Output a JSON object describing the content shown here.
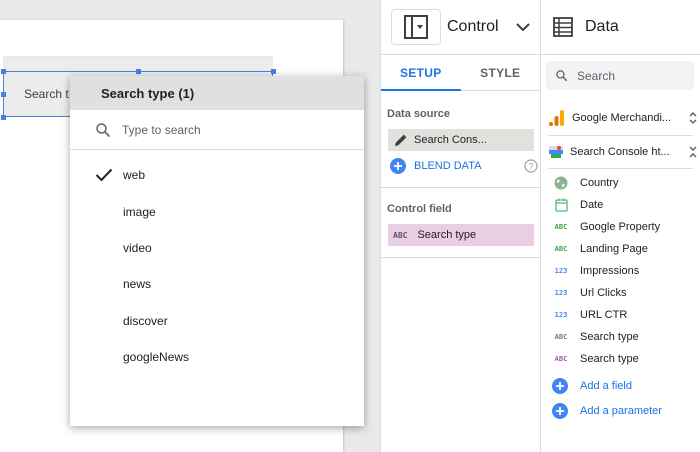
{
  "canvas": {
    "control_label": "Search t"
  },
  "dropdown": {
    "header": "Search type (1)",
    "search_placeholder": "Type to search",
    "options": [
      {
        "label": "web",
        "checked": true
      },
      {
        "label": "image",
        "checked": false
      },
      {
        "label": "video",
        "checked": false
      },
      {
        "label": "news",
        "checked": false
      },
      {
        "label": "discover",
        "checked": false
      },
      {
        "label": "googleNews",
        "checked": false
      }
    ]
  },
  "setup_panel": {
    "title": "Control",
    "tabs": [
      {
        "label": "SETUP",
        "active": true
      },
      {
        "label": "STYLE",
        "active": false
      }
    ],
    "data_source_label": "Data source",
    "data_source_value": "Search Cons...",
    "blend_label": "BLEND DATA",
    "control_field_label": "Control field",
    "control_field_type": "ABC",
    "control_field_value": "Search type"
  },
  "data_panel": {
    "title": "Data",
    "search_placeholder": "Search",
    "sources": [
      {
        "label": "Google Merchandi...",
        "icon": "analytics-icon"
      },
      {
        "label": "Search Console ht...",
        "icon": "search-console-icon"
      }
    ],
    "fields": [
      {
        "label": "Country",
        "type": "geo"
      },
      {
        "label": "Date",
        "type": "date"
      },
      {
        "label": "Google Property",
        "type": "ABC"
      },
      {
        "label": "Landing Page",
        "type": "ABC"
      },
      {
        "label": "Impressions",
        "type": "123"
      },
      {
        "label": "Url Clicks",
        "type": "123"
      },
      {
        "label": "URL CTR",
        "type": "123"
      },
      {
        "label": "Search type",
        "type": "ABC-purple"
      },
      {
        "label": "Search type",
        "type": "ABC-purple"
      }
    ],
    "add_field_label": "Add a field",
    "add_parameter_label": "Add a parameter"
  },
  "colors": {
    "accent": "#1a73e8",
    "dimension_green": "#34a853",
    "metric_blue": "#4285f4",
    "parameter_purple": "#9e5fa8"
  }
}
